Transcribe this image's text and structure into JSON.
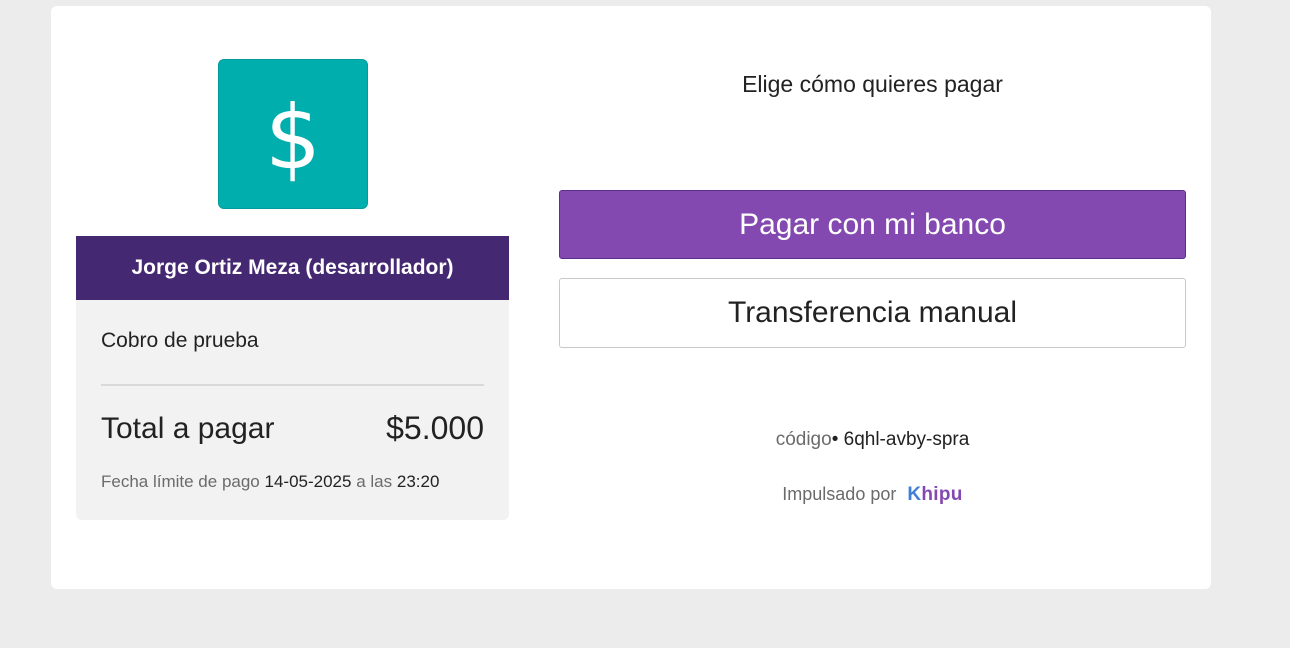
{
  "merchant": {
    "logo_icon": "dollar-sign-icon",
    "logo_color": "#00aeae",
    "name": "Jorge Ortiz Meza (desarrollador)",
    "header_color": "#452872"
  },
  "payment": {
    "description": "Cobro de prueba",
    "total_label": "Total a pagar",
    "total_amount": "$5.000",
    "deadline_prefix": "Fecha límite de pago",
    "deadline_date": "14-05-2025",
    "deadline_connector": "a las",
    "deadline_time": "23:20"
  },
  "options": {
    "title": "Elige cómo quieres pagar",
    "bank_button_label": "Pagar con mi banco",
    "bank_button_color": "#8449b0",
    "manual_button_label": "Transferencia manual"
  },
  "footer": {
    "code_label": "código",
    "code_separator": "•",
    "code_value": "6qhl-avby-spra",
    "powered_by": "Impulsado por",
    "brand_first_letter": "K",
    "brand_rest": "hipu"
  }
}
